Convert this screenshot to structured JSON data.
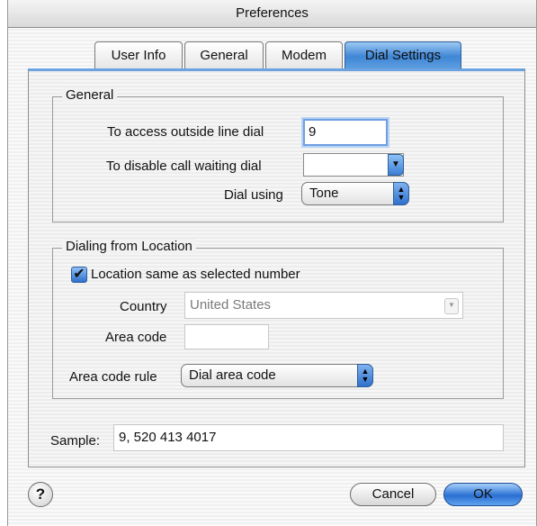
{
  "window": {
    "title": "Preferences"
  },
  "tabs": [
    {
      "label": "User Info",
      "active": false
    },
    {
      "label": "General",
      "active": false
    },
    {
      "label": "Modem",
      "active": false
    },
    {
      "label": "Dial Settings",
      "active": true
    }
  ],
  "general_group": {
    "title": "General",
    "outside_line_label": "To access outside line dial",
    "outside_line_value": "9",
    "call_waiting_label": "To disable call waiting dial",
    "call_waiting_value": "",
    "dial_using_label": "Dial using",
    "dial_using_value": "Tone"
  },
  "location_group": {
    "title": "Dialing from Location",
    "same_location_label": "Location same as selected number",
    "same_location_checked": true,
    "country_label": "Country",
    "country_value": "United States",
    "area_code_label": "Area code",
    "area_code_value": "",
    "area_code_rule_label": "Area code rule",
    "area_code_rule_value": "Dial area code"
  },
  "sample": {
    "label": "Sample:",
    "value": "9, 520 413 4017"
  },
  "buttons": {
    "help": "?",
    "cancel": "Cancel",
    "ok": "OK"
  },
  "colors": {
    "accent": "#3f86d6",
    "default_button": "#2a6fd2"
  }
}
